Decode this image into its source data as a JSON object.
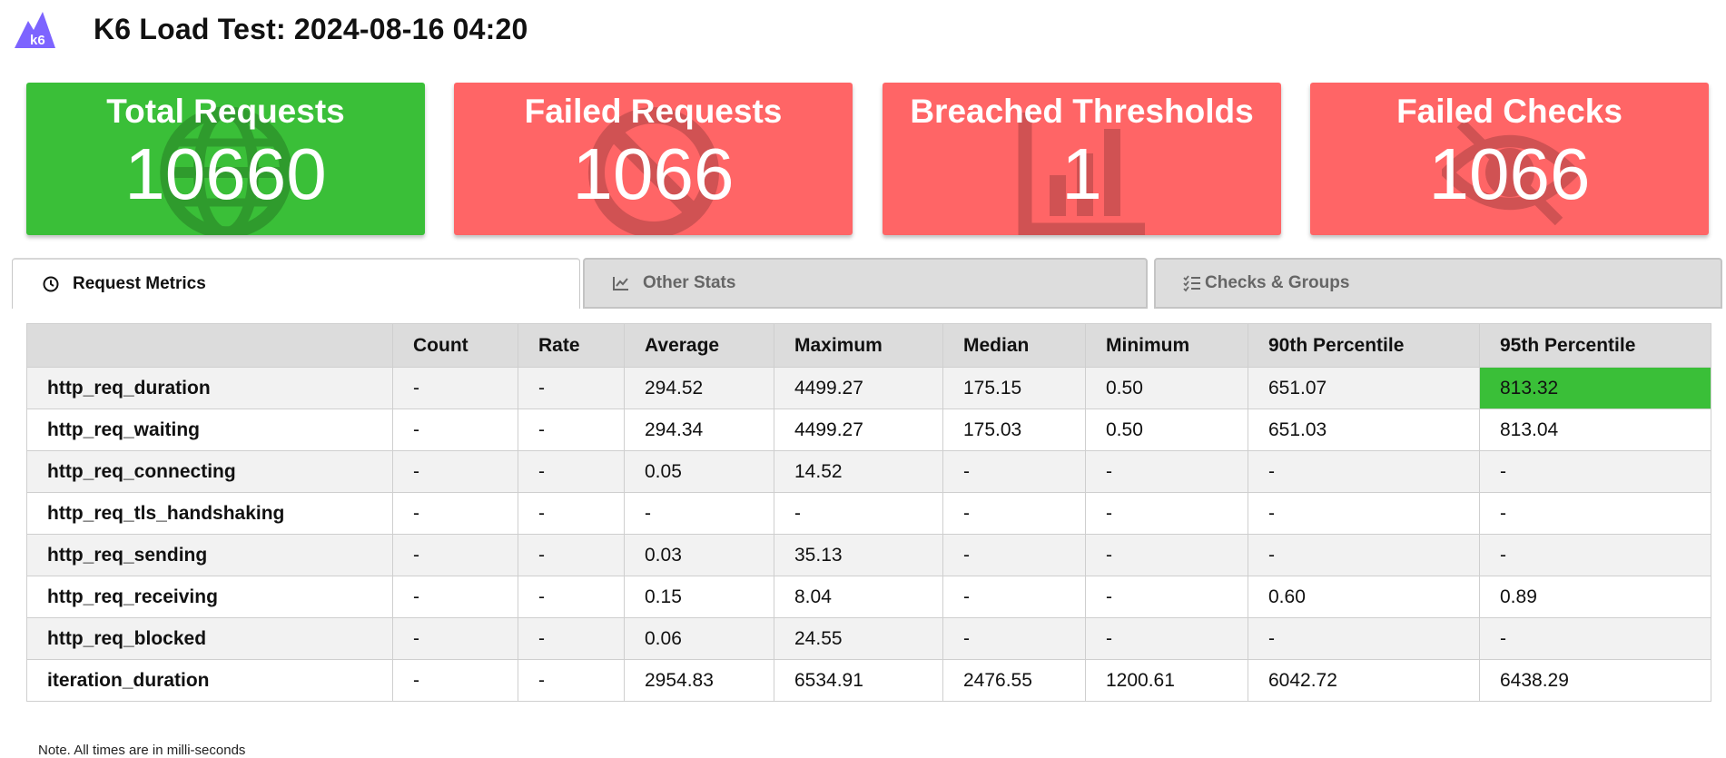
{
  "header": {
    "title": "K6 Load Test: 2024-08-16 04:20",
    "logo_text": "k6"
  },
  "cards": [
    {
      "label": "Total Requests",
      "value": "10660",
      "color": "#3abf38",
      "icon": "globe-icon"
    },
    {
      "label": "Failed Requests",
      "value": "1066",
      "color": "#ff6566",
      "icon": "block-icon"
    },
    {
      "label": "Breached Thresholds",
      "value": "1",
      "color": "#ff6566",
      "icon": "bar-chart-icon"
    },
    {
      "label": "Failed Checks",
      "value": "1066",
      "color": "#ff6566",
      "icon": "eye-icon"
    }
  ],
  "tabs": [
    {
      "label": "Request Metrics",
      "icon": "clock-icon",
      "active": true
    },
    {
      "label": "Other Stats",
      "icon": "line-chart-icon",
      "active": false
    },
    {
      "label": "Checks & Groups",
      "icon": "checklist-icon",
      "active": false
    }
  ],
  "table": {
    "columns": [
      "",
      "Count",
      "Rate",
      "Average",
      "Maximum",
      "Median",
      "Minimum",
      "90th Percentile",
      "95th Percentile"
    ],
    "rows": [
      [
        "http_req_duration",
        "-",
        "-",
        "294.52",
        "4499.27",
        "175.15",
        "0.50",
        "651.07",
        "813.32"
      ],
      [
        "http_req_waiting",
        "-",
        "-",
        "294.34",
        "4499.27",
        "175.03",
        "0.50",
        "651.03",
        "813.04"
      ],
      [
        "http_req_connecting",
        "-",
        "-",
        "0.05",
        "14.52",
        "-",
        "-",
        "-",
        "-"
      ],
      [
        "http_req_tls_handshaking",
        "-",
        "-",
        "-",
        "-",
        "-",
        "-",
        "-",
        "-"
      ],
      [
        "http_req_sending",
        "-",
        "-",
        "0.03",
        "35.13",
        "-",
        "-",
        "-",
        "-"
      ],
      [
        "http_req_receiving",
        "-",
        "-",
        "0.15",
        "8.04",
        "-",
        "-",
        "0.60",
        "0.89"
      ],
      [
        "http_req_blocked",
        "-",
        "-",
        "0.06",
        "24.55",
        "-",
        "-",
        "-",
        "-"
      ],
      [
        "iteration_duration",
        "-",
        "-",
        "2954.83",
        "6534.91",
        "2476.55",
        "1200.61",
        "6042.72",
        "6438.29"
      ]
    ],
    "highlight_color": "#3abf38"
  },
  "note": "Note. All times are in milli-seconds"
}
